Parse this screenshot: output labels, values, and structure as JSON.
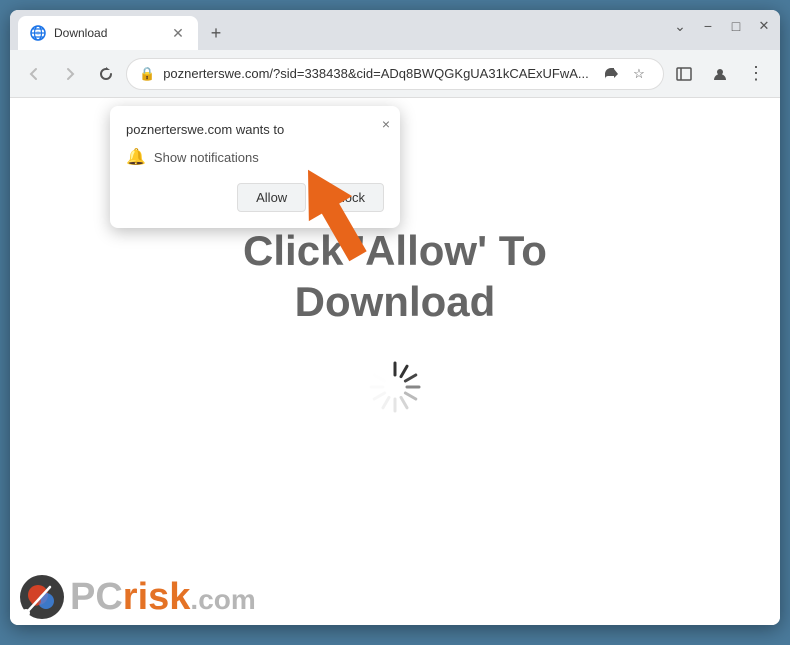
{
  "browser": {
    "title_bar": {
      "tab_title": "Download",
      "new_tab_icon": "+",
      "window_controls": {
        "minimize": "−",
        "maximize": "□",
        "close": "✕",
        "chevron": "⌄"
      }
    },
    "nav_bar": {
      "back_icon": "←",
      "forward_icon": "→",
      "refresh_icon": "↻",
      "address": "poznerterswe.com/?sid=338438&cid=ADq8BWQGKgUA31kCAExUFwA...",
      "lock_icon": "🔒",
      "share_icon": "⬡",
      "bookmark_icon": "☆",
      "browser_icon": "□",
      "profile_icon": "⊙",
      "menu_icon": "⋮"
    },
    "notification_popup": {
      "site_name": "poznerterswe.com wants to",
      "notification_label": "Show notifications",
      "close_icon": "×",
      "allow_button": "Allow",
      "block_button": "Block"
    },
    "page": {
      "main_text_line1": "Click 'Allow' To",
      "main_text_line2": "Download"
    },
    "watermark": {
      "pc_text": "PC",
      "risk_text": "risk",
      "domain": ".com"
    }
  }
}
